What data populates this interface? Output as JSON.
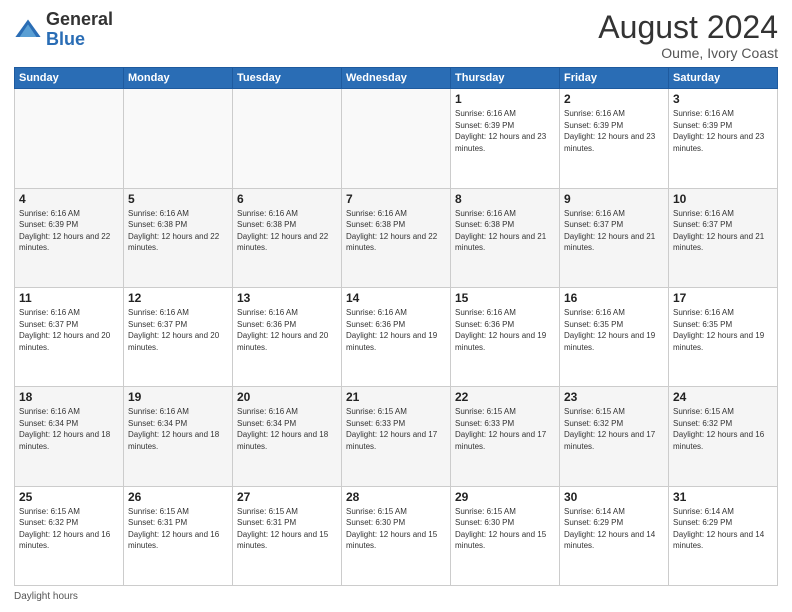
{
  "header": {
    "logo_general": "General",
    "logo_blue": "Blue",
    "month_title": "August 2024",
    "location": "Oume, Ivory Coast"
  },
  "days_of_week": [
    "Sunday",
    "Monday",
    "Tuesday",
    "Wednesday",
    "Thursday",
    "Friday",
    "Saturday"
  ],
  "footer": {
    "daylight_label": "Daylight hours"
  },
  "weeks": [
    [
      {
        "day": "",
        "info": ""
      },
      {
        "day": "",
        "info": ""
      },
      {
        "day": "",
        "info": ""
      },
      {
        "day": "",
        "info": ""
      },
      {
        "day": "1",
        "info": "Sunrise: 6:16 AM\nSunset: 6:39 PM\nDaylight: 12 hours and 23 minutes."
      },
      {
        "day": "2",
        "info": "Sunrise: 6:16 AM\nSunset: 6:39 PM\nDaylight: 12 hours and 23 minutes."
      },
      {
        "day": "3",
        "info": "Sunrise: 6:16 AM\nSunset: 6:39 PM\nDaylight: 12 hours and 23 minutes."
      }
    ],
    [
      {
        "day": "4",
        "info": "Sunrise: 6:16 AM\nSunset: 6:39 PM\nDaylight: 12 hours and 22 minutes."
      },
      {
        "day": "5",
        "info": "Sunrise: 6:16 AM\nSunset: 6:38 PM\nDaylight: 12 hours and 22 minutes."
      },
      {
        "day": "6",
        "info": "Sunrise: 6:16 AM\nSunset: 6:38 PM\nDaylight: 12 hours and 22 minutes."
      },
      {
        "day": "7",
        "info": "Sunrise: 6:16 AM\nSunset: 6:38 PM\nDaylight: 12 hours and 22 minutes."
      },
      {
        "day": "8",
        "info": "Sunrise: 6:16 AM\nSunset: 6:38 PM\nDaylight: 12 hours and 21 minutes."
      },
      {
        "day": "9",
        "info": "Sunrise: 6:16 AM\nSunset: 6:37 PM\nDaylight: 12 hours and 21 minutes."
      },
      {
        "day": "10",
        "info": "Sunrise: 6:16 AM\nSunset: 6:37 PM\nDaylight: 12 hours and 21 minutes."
      }
    ],
    [
      {
        "day": "11",
        "info": "Sunrise: 6:16 AM\nSunset: 6:37 PM\nDaylight: 12 hours and 20 minutes."
      },
      {
        "day": "12",
        "info": "Sunrise: 6:16 AM\nSunset: 6:37 PM\nDaylight: 12 hours and 20 minutes."
      },
      {
        "day": "13",
        "info": "Sunrise: 6:16 AM\nSunset: 6:36 PM\nDaylight: 12 hours and 20 minutes."
      },
      {
        "day": "14",
        "info": "Sunrise: 6:16 AM\nSunset: 6:36 PM\nDaylight: 12 hours and 19 minutes."
      },
      {
        "day": "15",
        "info": "Sunrise: 6:16 AM\nSunset: 6:36 PM\nDaylight: 12 hours and 19 minutes."
      },
      {
        "day": "16",
        "info": "Sunrise: 6:16 AM\nSunset: 6:35 PM\nDaylight: 12 hours and 19 minutes."
      },
      {
        "day": "17",
        "info": "Sunrise: 6:16 AM\nSunset: 6:35 PM\nDaylight: 12 hours and 19 minutes."
      }
    ],
    [
      {
        "day": "18",
        "info": "Sunrise: 6:16 AM\nSunset: 6:34 PM\nDaylight: 12 hours and 18 minutes."
      },
      {
        "day": "19",
        "info": "Sunrise: 6:16 AM\nSunset: 6:34 PM\nDaylight: 12 hours and 18 minutes."
      },
      {
        "day": "20",
        "info": "Sunrise: 6:16 AM\nSunset: 6:34 PM\nDaylight: 12 hours and 18 minutes."
      },
      {
        "day": "21",
        "info": "Sunrise: 6:15 AM\nSunset: 6:33 PM\nDaylight: 12 hours and 17 minutes."
      },
      {
        "day": "22",
        "info": "Sunrise: 6:15 AM\nSunset: 6:33 PM\nDaylight: 12 hours and 17 minutes."
      },
      {
        "day": "23",
        "info": "Sunrise: 6:15 AM\nSunset: 6:32 PM\nDaylight: 12 hours and 17 minutes."
      },
      {
        "day": "24",
        "info": "Sunrise: 6:15 AM\nSunset: 6:32 PM\nDaylight: 12 hours and 16 minutes."
      }
    ],
    [
      {
        "day": "25",
        "info": "Sunrise: 6:15 AM\nSunset: 6:32 PM\nDaylight: 12 hours and 16 minutes."
      },
      {
        "day": "26",
        "info": "Sunrise: 6:15 AM\nSunset: 6:31 PM\nDaylight: 12 hours and 16 minutes."
      },
      {
        "day": "27",
        "info": "Sunrise: 6:15 AM\nSunset: 6:31 PM\nDaylight: 12 hours and 15 minutes."
      },
      {
        "day": "28",
        "info": "Sunrise: 6:15 AM\nSunset: 6:30 PM\nDaylight: 12 hours and 15 minutes."
      },
      {
        "day": "29",
        "info": "Sunrise: 6:15 AM\nSunset: 6:30 PM\nDaylight: 12 hours and 15 minutes."
      },
      {
        "day": "30",
        "info": "Sunrise: 6:14 AM\nSunset: 6:29 PM\nDaylight: 12 hours and 14 minutes."
      },
      {
        "day": "31",
        "info": "Sunrise: 6:14 AM\nSunset: 6:29 PM\nDaylight: 12 hours and 14 minutes."
      }
    ]
  ]
}
